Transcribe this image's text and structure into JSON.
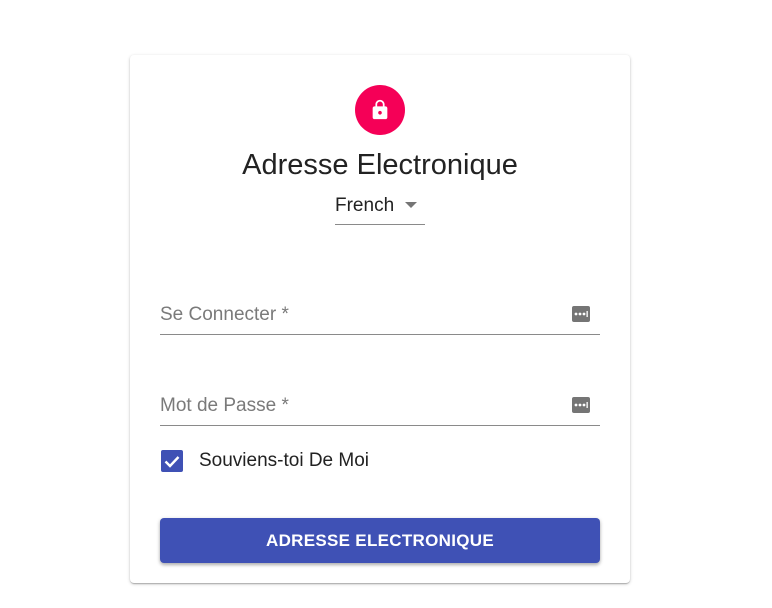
{
  "colors": {
    "accent": "#f50057",
    "primary": "#3f51b5",
    "text": "#222222",
    "muted": "#7a7a7a"
  },
  "header": {
    "icon": "lock-icon",
    "title": "Adresse Electronique"
  },
  "language": {
    "selected": "French",
    "icon": "caret-down-icon"
  },
  "form": {
    "username": {
      "label": "Se Connecter *",
      "value": "",
      "icon": "password-dots-icon"
    },
    "password": {
      "label": "Mot de Passe *",
      "value": "",
      "icon": "password-dots-icon"
    },
    "remember": {
      "label": "Souviens-toi De Moi",
      "checked": true
    },
    "submit_label": "ADRESSE ELECTRONIQUE"
  }
}
